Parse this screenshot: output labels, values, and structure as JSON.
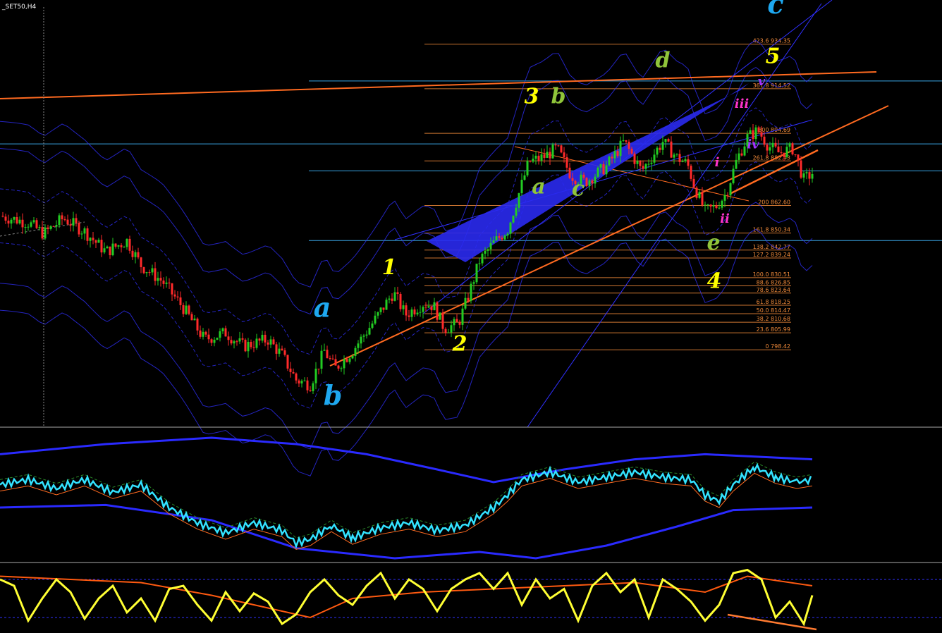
{
  "symbol": "_SET50,H4",
  "colors": {
    "background": "#000000",
    "bull": "#22cc22",
    "bear": "#ff2a2a",
    "fib": "#f08a3a",
    "trend": "#ff6a20",
    "hline": "#3aa6e6",
    "envelope": "#3030ff",
    "osc_main": "#33e3ff",
    "stoch": "#ffff33"
  },
  "chart_data": {
    "type": "candlestick",
    "timeframe": "H4",
    "ylim": [
      764,
      954
    ],
    "close_path": [
      [
        0,
        858
      ],
      [
        40,
        855
      ],
      [
        62,
        850
      ],
      [
        90,
        857
      ],
      [
        120,
        851
      ],
      [
        150,
        842
      ],
      [
        180,
        847
      ],
      [
        200,
        836
      ],
      [
        230,
        829
      ],
      [
        260,
        817
      ],
      [
        290,
        803
      ],
      [
        320,
        806
      ],
      [
        345,
        800
      ],
      [
        380,
        803
      ],
      [
        400,
        796
      ],
      [
        420,
        785
      ],
      [
        440,
        783
      ],
      [
        460,
        798
      ],
      [
        475,
        790
      ],
      [
        500,
        798
      ],
      [
        530,
        811
      ],
      [
        558,
        824
      ],
      [
        575,
        814
      ],
      [
        600,
        819
      ],
      [
        615,
        818
      ],
      [
        630,
        808
      ],
      [
        650,
        810
      ],
      [
        665,
        823
      ],
      [
        680,
        838
      ],
      [
        700,
        846
      ],
      [
        720,
        852
      ],
      [
        735,
        867
      ],
      [
        750,
        882
      ],
      [
        770,
        884
      ],
      [
        790,
        888
      ],
      [
        810,
        876
      ],
      [
        830,
        873
      ],
      [
        860,
        880
      ],
      [
        885,
        891
      ],
      [
        910,
        878
      ],
      [
        940,
        891
      ],
      [
        960,
        884
      ],
      [
        975,
        881
      ],
      [
        985,
        871
      ],
      [
        1000,
        860
      ],
      [
        1015,
        862
      ],
      [
        1030,
        868
      ],
      [
        1045,
        883
      ],
      [
        1060,
        893
      ],
      [
        1075,
        896
      ],
      [
        1090,
        889
      ],
      [
        1105,
        886
      ],
      [
        1125,
        888
      ],
      [
        1140,
        874
      ],
      [
        1152,
        877
      ]
    ],
    "fib_levels": [
      {
        "ratio": "423.6",
        "price": "934.35"
      },
      {
        "ratio": "361.8",
        "price": "914.52"
      },
      {
        "ratio": "300",
        "price": "894.69"
      },
      {
        "ratio": "261.8",
        "price": "882.43"
      },
      {
        "ratio": "200",
        "price": "862.60"
      },
      {
        "ratio": "161.8",
        "price": "850.34"
      },
      {
        "ratio": "138.2",
        "price": "842.77"
      },
      {
        "ratio": "127.2",
        "price": "839.24"
      },
      {
        "ratio": "100.0",
        "price": "830.51"
      },
      {
        "ratio": "88.6",
        "price": "826.85"
      },
      {
        "ratio": "78.6",
        "price": "823.64"
      },
      {
        "ratio": "61.8",
        "price": "818.25"
      },
      {
        "ratio": "50.0",
        "price": "814.47"
      },
      {
        "ratio": "38.2",
        "price": "810.68"
      },
      {
        "ratio": "23.6",
        "price": "805.99"
      },
      {
        "ratio": "0",
        "price": "798.42"
      }
    ],
    "wave_labels": [
      {
        "text": "c",
        "price": 948,
        "bar": 1100,
        "color": "#1ea8f0"
      },
      {
        "text": "a",
        "price": 813,
        "bar": 457,
        "color": "#1ea8f0"
      },
      {
        "text": "b",
        "price": 774,
        "bar": 472,
        "color": "#1ea8f0"
      },
      {
        "text": "1",
        "price": 832,
        "bar": 552,
        "color": "#ffff00"
      },
      {
        "text": "2",
        "price": 798,
        "bar": 652,
        "color": "#ffff00"
      },
      {
        "text": "3",
        "price": 908,
        "bar": 754,
        "color": "#ffff00"
      },
      {
        "text": "4",
        "price": 826,
        "bar": 1013,
        "color": "#ffff00"
      },
      {
        "text": "5",
        "price": 926,
        "bar": 1096,
        "color": "#ffff00"
      },
      {
        "text": "a",
        "price": 868,
        "bar": 764,
        "color": "#8fc43a"
      },
      {
        "text": "b",
        "price": 908,
        "bar": 792,
        "color": "#8fc43a"
      },
      {
        "text": "c",
        "price": 867,
        "bar": 820,
        "color": "#8fc43a"
      },
      {
        "text": "d",
        "price": 924,
        "bar": 940,
        "color": "#8fc43a"
      },
      {
        "text": "e",
        "price": 843,
        "bar": 1012,
        "color": "#8fc43a"
      },
      {
        "text": "i",
        "price": 880,
        "bar": 1017,
        "color": "#ff33cc"
      },
      {
        "text": "ii",
        "price": 855,
        "bar": 1028,
        "color": "#ff33cc"
      },
      {
        "text": "iii",
        "price": 906,
        "bar": 1052,
        "color": "#ff33cc"
      },
      {
        "text": "iv",
        "price": 888,
        "bar": 1068,
        "color": "#a033ff"
      },
      {
        "text": "v",
        "price": 916,
        "bar": 1080,
        "color": "#a033ff"
      }
    ],
    "h_lines": [
      918,
      890,
      878,
      847
    ],
    "oscillator": {
      "main": [
        [
          0,
          0.42
        ],
        [
          40,
          0.38
        ],
        [
          80,
          0.45
        ],
        [
          120,
          0.38
        ],
        [
          160,
          0.48
        ],
        [
          200,
          0.42
        ],
        [
          240,
          0.6
        ],
        [
          280,
          0.72
        ],
        [
          320,
          0.8
        ],
        [
          360,
          0.72
        ],
        [
          400,
          0.78
        ],
        [
          420,
          0.88
        ],
        [
          440,
          0.85
        ],
        [
          470,
          0.74
        ],
        [
          500,
          0.84
        ],
        [
          540,
          0.76
        ],
        [
          580,
          0.72
        ],
        [
          620,
          0.78
        ],
        [
          660,
          0.74
        ],
        [
          700,
          0.6
        ],
        [
          720,
          0.5
        ],
        [
          740,
          0.38
        ],
        [
          780,
          0.32
        ],
        [
          820,
          0.4
        ],
        [
          860,
          0.36
        ],
        [
          900,
          0.32
        ],
        [
          940,
          0.36
        ],
        [
          980,
          0.38
        ],
        [
          1000,
          0.5
        ],
        [
          1020,
          0.55
        ],
        [
          1040,
          0.42
        ],
        [
          1070,
          0.28
        ],
        [
          1100,
          0.36
        ],
        [
          1130,
          0.4
        ],
        [
          1152,
          0.38
        ]
      ],
      "upper_band": [
        [
          0,
          0.18
        ],
        [
          150,
          0.1
        ],
        [
          300,
          0.05
        ],
        [
          420,
          0.1
        ],
        [
          520,
          0.18
        ],
        [
          620,
          0.3
        ],
        [
          700,
          0.4
        ],
        [
          800,
          0.3
        ],
        [
          900,
          0.22
        ],
        [
          1000,
          0.18
        ],
        [
          1152,
          0.22
        ]
      ],
      "lower_band": [
        [
          0,
          0.6
        ],
        [
          150,
          0.58
        ],
        [
          300,
          0.7
        ],
        [
          420,
          0.92
        ],
        [
          560,
          1.0
        ],
        [
          680,
          0.95
        ],
        [
          760,
          1.0
        ],
        [
          860,
          0.9
        ],
        [
          960,
          0.75
        ],
        [
          1040,
          0.62
        ],
        [
          1152,
          0.6
        ]
      ]
    },
    "stochastic": {
      "main": [
        [
          0,
          0.2
        ],
        [
          20,
          0.3
        ],
        [
          40,
          0.85
        ],
        [
          60,
          0.5
        ],
        [
          80,
          0.2
        ],
        [
          100,
          0.4
        ],
        [
          120,
          0.82
        ],
        [
          140,
          0.5
        ],
        [
          160,
          0.3
        ],
        [
          180,
          0.72
        ],
        [
          200,
          0.5
        ],
        [
          220,
          0.85
        ],
        [
          240,
          0.35
        ],
        [
          260,
          0.3
        ],
        [
          280,
          0.6
        ],
        [
          300,
          0.85
        ],
        [
          320,
          0.4
        ],
        [
          340,
          0.7
        ],
        [
          360,
          0.42
        ],
        [
          380,
          0.55
        ],
        [
          400,
          0.9
        ],
        [
          420,
          0.75
        ],
        [
          440,
          0.4
        ],
        [
          460,
          0.2
        ],
        [
          480,
          0.45
        ],
        [
          500,
          0.6
        ],
        [
          520,
          0.3
        ],
        [
          540,
          0.1
        ],
        [
          560,
          0.5
        ],
        [
          580,
          0.2
        ],
        [
          600,
          0.35
        ],
        [
          620,
          0.7
        ],
        [
          640,
          0.35
        ],
        [
          660,
          0.2
        ],
        [
          680,
          0.1
        ],
        [
          700,
          0.35
        ],
        [
          720,
          0.1
        ],
        [
          740,
          0.6
        ],
        [
          760,
          0.2
        ],
        [
          780,
          0.5
        ],
        [
          800,
          0.35
        ],
        [
          820,
          0.85
        ],
        [
          840,
          0.3
        ],
        [
          860,
          0.1
        ],
        [
          880,
          0.4
        ],
        [
          900,
          0.2
        ],
        [
          920,
          0.8
        ],
        [
          940,
          0.2
        ],
        [
          960,
          0.35
        ],
        [
          980,
          0.55
        ],
        [
          1000,
          0.85
        ],
        [
          1020,
          0.6
        ],
        [
          1040,
          0.1
        ],
        [
          1060,
          0.05
        ],
        [
          1080,
          0.2
        ],
        [
          1100,
          0.8
        ],
        [
          1120,
          0.55
        ],
        [
          1140,
          0.9
        ],
        [
          1152,
          0.45
        ]
      ],
      "signal": [
        [
          0,
          0.15
        ],
        [
          100,
          0.2
        ],
        [
          200,
          0.25
        ],
        [
          300,
          0.45
        ],
        [
          400,
          0.7
        ],
        [
          440,
          0.8
        ],
        [
          500,
          0.5
        ],
        [
          600,
          0.4
        ],
        [
          700,
          0.35
        ],
        [
          800,
          0.3
        ],
        [
          900,
          0.25
        ],
        [
          1000,
          0.4
        ],
        [
          1060,
          0.15
        ],
        [
          1152,
          0.3
        ]
      ]
    }
  }
}
